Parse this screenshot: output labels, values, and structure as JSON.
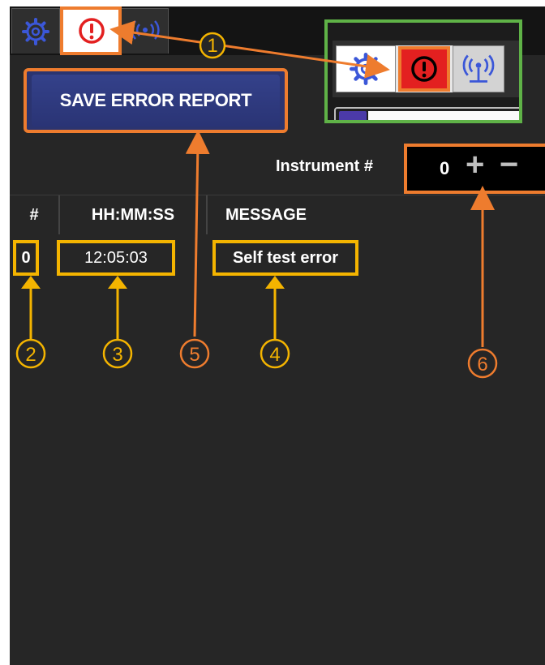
{
  "colors": {
    "annotation_orange": "#ee7c2e",
    "annotation_yellow": "#f4b400",
    "inset_border_green": "#5fb247",
    "error_red": "#e32020",
    "save_button_blue": "#2f3b80",
    "network_blue": "#3b57d8",
    "app_background": "#262626"
  },
  "tabs": [
    {
      "name": "settings",
      "icon": "gear-icon"
    },
    {
      "name": "errors",
      "icon": "alert-circle-icon",
      "active": true
    },
    {
      "name": "network",
      "icon": "antenna-icon"
    }
  ],
  "toolbar": {
    "save_label": "SAVE ERROR REPORT"
  },
  "instrument": {
    "label": "Instrument #",
    "value": "0",
    "increment_icon": "plus-icon",
    "decrement_icon": "minus-icon"
  },
  "table": {
    "headers": [
      "#",
      "HH:MM:SS",
      "MESSAGE"
    ],
    "rows": [
      {
        "num": "0",
        "time": "12:05:03",
        "message": "Self test error"
      }
    ]
  },
  "callouts": [
    "①",
    "②",
    "③",
    "④",
    "⑤",
    "⑥"
  ]
}
